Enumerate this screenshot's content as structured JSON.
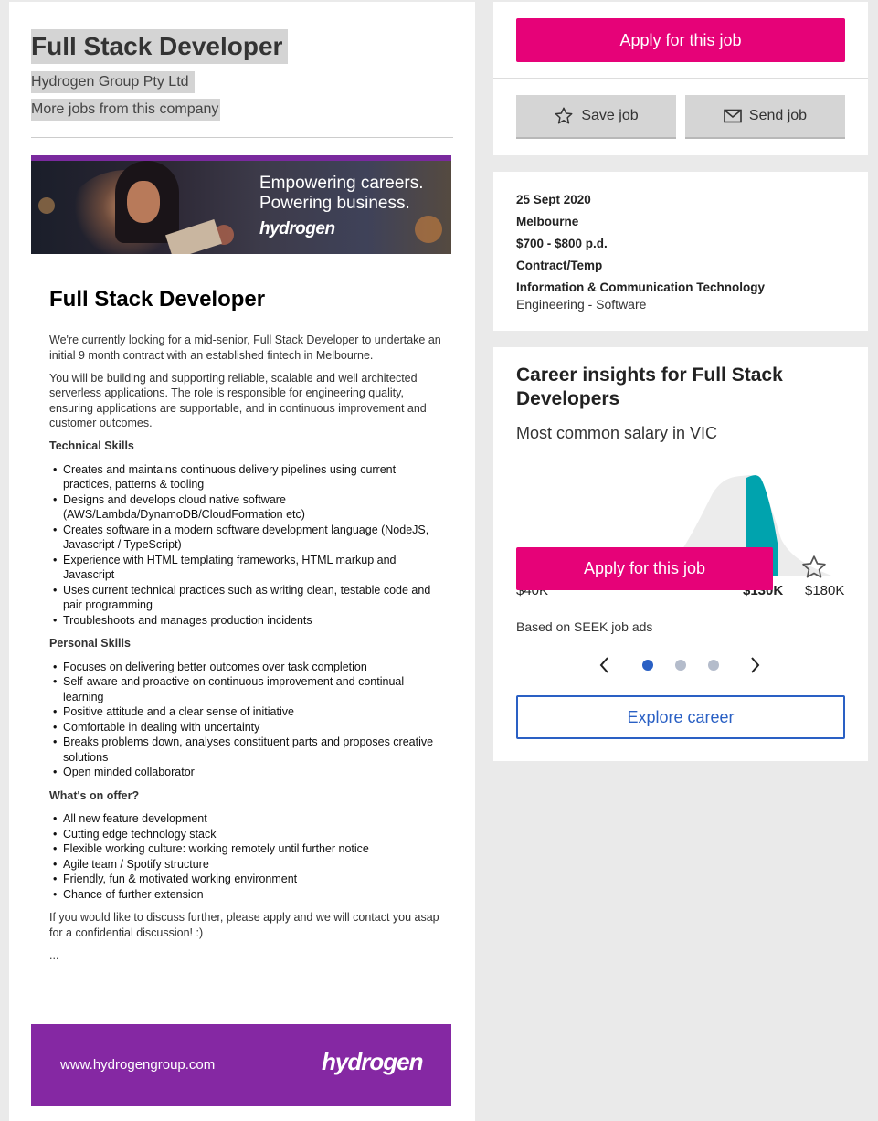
{
  "job": {
    "title": "Full Stack Developer",
    "company": "Hydrogen Group Pty Ltd",
    "more_jobs": "More jobs from this company"
  },
  "banner": {
    "tagline_1": "Empowering careers.",
    "tagline_2": "Powering business.",
    "logo": "hydrogen"
  },
  "ad": {
    "title": "Full Stack Developer",
    "intro": [
      "We're currently looking for a mid-senior, Full Stack Developer to undertake an initial 9 month contract with an established fintech in Melbourne.",
      "You will be building and supporting reliable, scalable and well architected serverless applications. The role is responsible for engineering quality, ensuring applications are supportable, and in continuous improvement and customer outcomes."
    ],
    "technical_heading": "Technical Skills",
    "technical_items": [
      "Creates and maintains continuous delivery pipelines using current practices, patterns & tooling",
      "Designs and develops cloud native software (AWS/Lambda/DynamoDB/CloudFormation etc)",
      "Creates software in a modern software development language (NodeJS, Javascript / TypeScript)",
      "Experience with HTML templating frameworks, HTML markup and Javascript",
      "Uses current technical practices such as writing clean, testable code and pair programming",
      "Troubleshoots and manages production incidents"
    ],
    "personal_heading": "Personal Skills",
    "personal_items": [
      "Focuses on delivering better outcomes over task completion",
      "Self-aware and proactive on continuous improvement and continual learning",
      "Positive attitude and a clear sense of initiative",
      "Comfortable in dealing with uncertainty",
      "Breaks problems down, analyses constituent parts and proposes creative solutions",
      "Open minded collaborator"
    ],
    "offer_heading": "What's on offer?",
    "offer_items": [
      "All new feature development",
      "Cutting edge technology stack",
      "Flexible working culture: working remotely until further notice",
      "Agile team / Spotify structure",
      "Friendly, fun & motivated working environment",
      "Chance of further extension"
    ],
    "closing": "If you would like to discuss further, please apply and we will contact you asap for a confidential discussion! :)",
    "ellipsis": "..."
  },
  "footer_banner": {
    "url": "www.hydrogengroup.com",
    "logo": "hydrogen"
  },
  "actions": {
    "apply_label": "Apply for this job",
    "save_label": "Save job",
    "send_label": "Send job"
  },
  "details": {
    "date": "25 Sept 2020",
    "location": "Melbourne",
    "salary": "$700 - $800 p.d.",
    "work_type": "Contract/Temp",
    "classification": "Information & Communication Technology",
    "sub_classification": "Engineering - Software"
  },
  "insights": {
    "title": "Career insights for Full Stack Developers",
    "subtitle": "Most common salary in VIC",
    "axis_low": "$40K",
    "axis_mid": "$130K",
    "axis_high": "$180K",
    "floating_apply_label": "Apply for this job",
    "based_on": "Based on SEEK job ads",
    "pager_total": 3,
    "pager_active": 1,
    "explore_label": "Explore career",
    "colors": {
      "highlight": "#00a3ae",
      "distribution": "#ececec"
    }
  },
  "icons": {
    "save": "star-icon",
    "send": "mail-icon",
    "chart_star": "star-icon",
    "prev": "chevron-left-icon",
    "next": "chevron-right-icon"
  },
  "colors": {
    "apply": "#e60278",
    "link": "#2a60c4",
    "banner_purple": "#8528a3"
  }
}
